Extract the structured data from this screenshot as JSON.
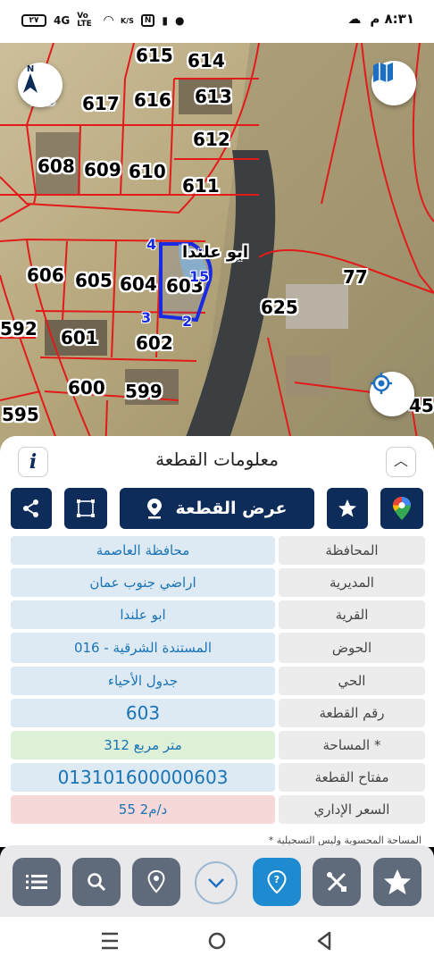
{
  "status_bar": {
    "time": "٨:٣١ م",
    "battery": "٢٧",
    "net_4g": "4G",
    "vo_lte": "Vo LTE",
    "speed": "K/S"
  },
  "map": {
    "parcels": [
      "615",
      "614",
      "617",
      "616",
      "613",
      "612",
      "608",
      "609",
      "610",
      "611",
      "606",
      "605",
      "604",
      "603",
      "601",
      "602",
      "600",
      "599",
      "592",
      "595",
      "77",
      "625",
      "45"
    ],
    "vertices": [
      "4",
      "15",
      "3",
      "2"
    ],
    "village_text": "ابو علندا"
  },
  "sheet": {
    "title": "معلومات القطعة",
    "view_parcel_label": "عرض القطعة",
    "rows": [
      {
        "label": "المحافظة",
        "value": "محافظة العاصمة"
      },
      {
        "label": "المديرية",
        "value": "اراضي جنوب عمان"
      },
      {
        "label": "القرية",
        "value": "ابو علندا"
      },
      {
        "label": "الحوض",
        "value": "المستندة الشرقية - 016"
      },
      {
        "label": "الحي",
        "value": "جدول الأحياء"
      },
      {
        "label": "رقم القطعة",
        "value": "603"
      },
      {
        "label": "المساحة *",
        "value": "312  متر مربع"
      },
      {
        "label": "مفتاح القطعة",
        "value": "013101600000603"
      },
      {
        "label": "السعر الإداري",
        "value": "55 د/م2"
      }
    ],
    "footnote": "* المساحة المحسوبة وليس التسجيلية"
  },
  "colors": {
    "navy": "#0d2c5a",
    "value_bg": "#dde9f3",
    "area_bg": "#dff0d8",
    "price_bg": "#f6d8d8",
    "toolbar_gray": "#5f6b7b",
    "toolbar_blue": "#1e8bd0"
  },
  "toolbar_icons": [
    "list-icon",
    "search-icon",
    "location-pin-icon",
    "chevron-down-icon",
    "help-pin-icon",
    "tools-icon",
    "star-icon"
  ]
}
